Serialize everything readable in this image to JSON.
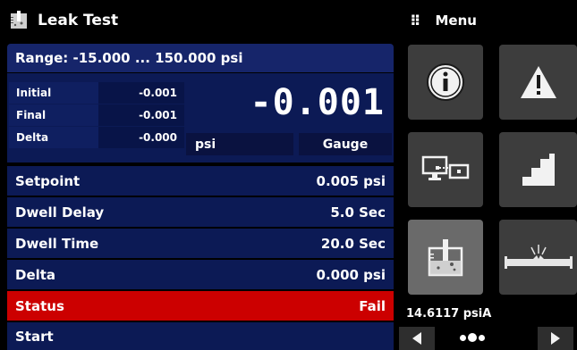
{
  "header": {
    "title": "Leak Test",
    "icon": "leak-test-icon"
  },
  "range": {
    "text": "Range: -15.000 ... 150.000 psi"
  },
  "readings": {
    "rows": [
      {
        "label": "Initial",
        "value": "-0.001"
      },
      {
        "label": "Final",
        "value": "-0.001"
      },
      {
        "label": "Delta",
        "value": "-0.000"
      }
    ],
    "main_value": "-0.001",
    "unit": "psi",
    "mode": "Gauge"
  },
  "params": [
    {
      "label": "Setpoint",
      "value": "0.005 psi"
    },
    {
      "label": "Dwell Delay",
      "value": "5.0 Sec"
    },
    {
      "label": "Dwell Time",
      "value": "20.0 Sec"
    },
    {
      "label": "Delta",
      "value": "0.000 psi"
    },
    {
      "label": "Status",
      "value": "Fail"
    },
    {
      "label": "Start",
      "value": ""
    }
  ],
  "menu": {
    "title": "Menu",
    "tiles": [
      {
        "name": "info-icon"
      },
      {
        "name": "warning-icon"
      },
      {
        "name": "remote-connection-icon"
      },
      {
        "name": "step-program-icon"
      },
      {
        "name": "leak-test-icon"
      },
      {
        "name": "burst-test-icon"
      }
    ]
  },
  "footer": {
    "barometer": "14.6117 psiA",
    "page_count": 3,
    "current_page": 2
  },
  "colors": {
    "panel": "#0c1a55",
    "range_bar": "#16256a",
    "status_fail": "#cc0000",
    "tile": "#3d3d3d",
    "tile_active": "#6a6a6a"
  }
}
